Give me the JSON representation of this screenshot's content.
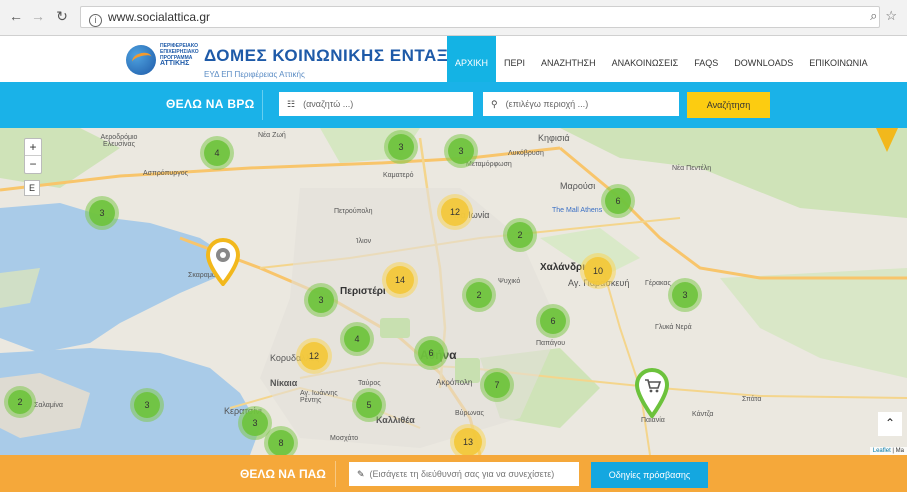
{
  "browser": {
    "url": "www.socialattica.gr",
    "back_icon": "arrow-left-icon",
    "forward_icon": "arrow-right-icon",
    "reload_icon": "reload-icon",
    "info_icon": "info-icon",
    "zoom_icon": "magnify-icon",
    "star_icon": "star-icon"
  },
  "header": {
    "logo_small_lines": [
      "ΠΕΡΙΦΕΡΕΙΑΚΟ",
      "ΕΠΙΧΕΙΡΗΣΙΑΚΟ",
      "ΠΡΟΓΡΑΜΜΑ"
    ],
    "logo_region": "ΑΤΤΙΚΗΣ",
    "logo_title": "ΔΟΜΕΣ ΚΟΙΝΩΝΙΚΗΣ ΕΝΤΑΞΗΣ",
    "logo_subtitle": "ΕΥΔ ΕΠ Περιφέρειας Αττικής",
    "menu": [
      {
        "label": "ΑΡΧΙΚΗ",
        "active": true
      },
      {
        "label": "ΠΕΡΙ",
        "active": false
      },
      {
        "label": "ΑΝΑΖΗΤΗΣΗ",
        "active": false
      },
      {
        "label": "ΑΝΑΚΟΙΝΩΣΕΙΣ",
        "active": false
      },
      {
        "label": "FAQS",
        "active": false
      },
      {
        "label": "DOWNLOADS",
        "active": false
      },
      {
        "label": "ΕΠΙΚΟΙΝΩΝΙΑ",
        "active": false
      }
    ]
  },
  "search": {
    "label": "ΘΕΛΩ ΝΑ ΒΡΩ",
    "what_placeholder": "(αναζητώ ...)",
    "where_placeholder": "(επιλέγω περιοχή ...)",
    "button": "Αναζήτηση"
  },
  "map": {
    "zoom_in": "+",
    "zoom_out": "−",
    "layer": "E",
    "clusters": [
      {
        "count": "4",
        "color": "green"
      },
      {
        "count": "3",
        "color": "green"
      },
      {
        "count": "3",
        "color": "green"
      },
      {
        "count": "3",
        "color": "green"
      },
      {
        "count": "6",
        "color": "green"
      },
      {
        "count": "12",
        "color": "yellow"
      },
      {
        "count": "2",
        "color": "green"
      },
      {
        "count": "14",
        "color": "yellow"
      },
      {
        "count": "10",
        "color": "yellow"
      },
      {
        "count": "3",
        "color": "green"
      },
      {
        "count": "2",
        "color": "green"
      },
      {
        "count": "3",
        "color": "green"
      },
      {
        "count": "6",
        "color": "green"
      },
      {
        "count": "4",
        "color": "green"
      },
      {
        "count": "12",
        "color": "yellow"
      },
      {
        "count": "6",
        "color": "green"
      },
      {
        "count": "7",
        "color": "green"
      },
      {
        "count": "5",
        "color": "green"
      },
      {
        "count": "3",
        "color": "green"
      },
      {
        "count": "3",
        "color": "green"
      },
      {
        "count": "8",
        "color": "green"
      },
      {
        "count": "13",
        "color": "yellow"
      },
      {
        "count": "2",
        "color": "green"
      }
    ],
    "places": [
      "Νέα Ζωή",
      "Ασπρόπυργος",
      "Αεροδρόμιο Ελευσίνας",
      "Κηφισιά",
      "Λυκόβρυση",
      "Μεταμόρφωση",
      "Μαρούσι",
      "Νέα Πεντέλη",
      "Καματερό",
      "Πετρούπολη",
      "Νέα Ιωνία",
      "Ίλιον",
      "The Mall Athens",
      "Χαλάνδρι",
      "Αγ. Παρασκευή",
      "Γέρακας",
      "Περιστέρι",
      "Ψυχικό",
      "Παπάγου",
      "Γλυκά Νερά",
      "Αθήνα",
      "Κορυδαλλός",
      "Νίκαια",
      "Αγ. Ιωάννης Ρέντης",
      "Ταύρος",
      "Ακρόπολη",
      "Βύρωνας",
      "Καλλιθέα",
      "Μοσχάτο",
      "Κερατσίνι",
      "Σκαραμαγκάς",
      "Σαλαμίνα",
      "Παιανία",
      "Κάντζα",
      "Σπάτα"
    ],
    "attribution_leaflet": "Leaflet",
    "attribution_rest": " | Ma"
  },
  "bottom": {
    "label": "ΘΕΛΩ ΝΑ ΠΑΩ",
    "placeholder": "(Εισάγετε τη διεύθυνσή σας για να συνεχίσετε)",
    "button": "Οδηγίες πρόσβασης"
  }
}
